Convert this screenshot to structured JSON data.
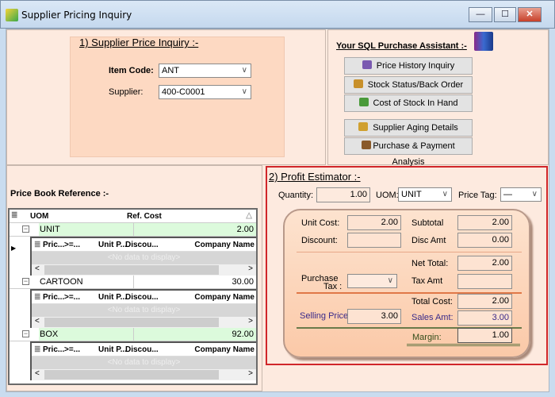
{
  "window": {
    "title": "Supplier Pricing Inquiry",
    "controls": {
      "minimize": "—",
      "maximize": "☐",
      "close": "✕"
    }
  },
  "inquiry": {
    "heading": "1) Supplier Price Inquiry :-",
    "item_code_label": "Item Code:",
    "item_code": "ANT",
    "supplier_label": "Supplier:",
    "supplier": "400-C0001"
  },
  "assistant": {
    "heading": "Your SQL Purchase Assistant :-",
    "buttons": [
      {
        "label": "Price History Inquiry",
        "icon": "chart-icon",
        "color": "#7a5ab0"
      },
      {
        "label": "Stock Status/Back Order",
        "icon": "boxes-icon",
        "color": "#c8902a"
      },
      {
        "label": "Cost of Stock In Hand",
        "icon": "cost-icon",
        "color": "#4a9a3a"
      },
      {
        "label": "Supplier Aging Details",
        "icon": "aging-icon",
        "color": "#d0a030"
      },
      {
        "label": "Purchase & Payment Analysis",
        "icon": "analysis-icon",
        "color": "#8a5a2a"
      }
    ]
  },
  "price_book": {
    "heading": "Price Book Reference :-",
    "columns": {
      "uom": "UOM",
      "ref_cost": "Ref. Cost"
    },
    "sub_columns": [
      "Pric...",
      ">=...",
      "Unit P...",
      "Discou...",
      "Company Name"
    ],
    "no_data": "<No data to display>",
    "rows": [
      {
        "uom": "UNIT",
        "ref_cost": "2.00"
      },
      {
        "uom": "CARTOON",
        "ref_cost": "30.00"
      },
      {
        "uom": "BOX",
        "ref_cost": "92.00"
      }
    ]
  },
  "estimator": {
    "heading": "2) Profit Estimator :-",
    "quantity_label": "Quantity:",
    "quantity": "1.00",
    "uom_label": "UOM:",
    "uom": "UNIT",
    "price_tag_label": "Price Tag:",
    "price_tag": "—",
    "unit_cost_label": "Unit Cost:",
    "unit_cost": "2.00",
    "discount_label": "Discount:",
    "discount": "",
    "subtotal_label": "Subtotal",
    "subtotal": "2.00",
    "disc_amt_label": "Disc Amt",
    "disc_amt": "0.00",
    "net_total_label": "Net Total:",
    "net_total": "2.00",
    "purchase_tax_label_1": "Purchase",
    "purchase_tax_label_2": "Tax :",
    "purchase_tax": "",
    "tax_amt_label": "Tax Amt",
    "tax_amt": "",
    "total_cost_label": "Total Cost:",
    "total_cost": "2.00",
    "selling_price_label": "Selling Price",
    "selling_price": "3.00",
    "sales_amt_label": "Sales Amt:",
    "sales_amt": "3.00",
    "margin_label": "Margin:",
    "margin": "1.00"
  }
}
